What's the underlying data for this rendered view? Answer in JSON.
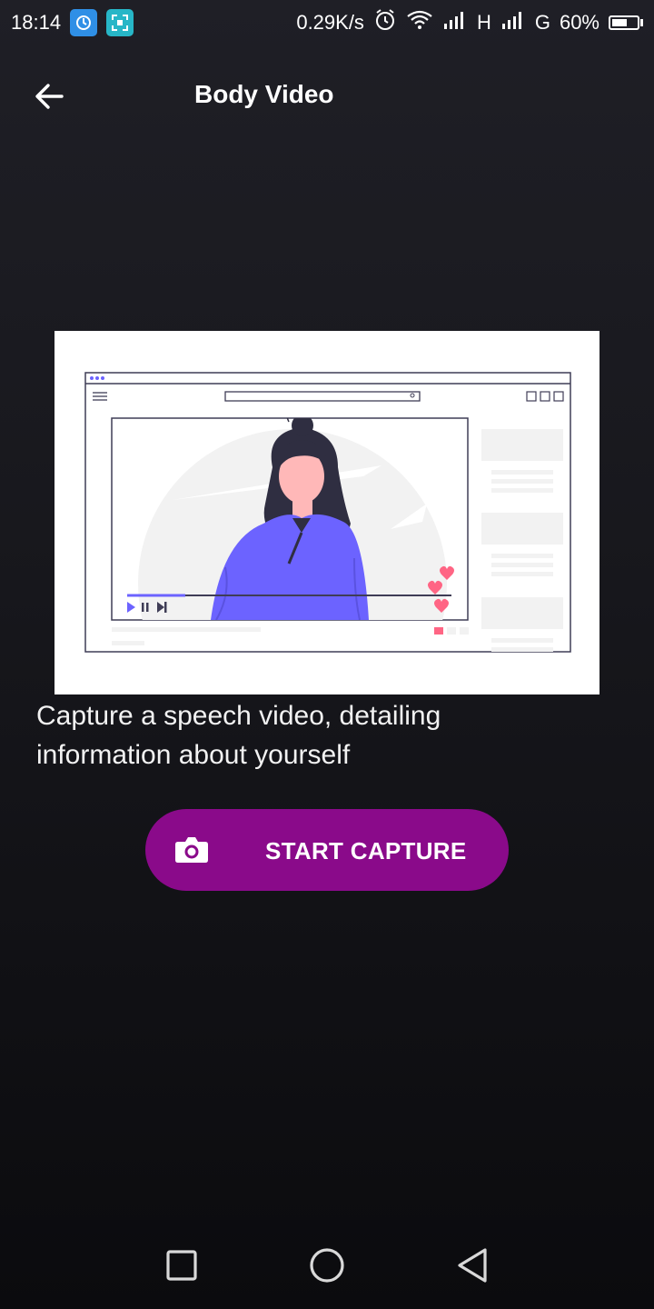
{
  "status_bar": {
    "time": "18:14",
    "net_speed": "0.29K/s",
    "signal_1_type": "H",
    "signal_2_type": "G",
    "battery_percent": "60%",
    "battery_level": 0.6,
    "icons": [
      "vpn-app-icon",
      "scan-app-icon",
      "alarm-icon",
      "wifi-icon",
      "signal-icon",
      "battery-icon"
    ]
  },
  "header": {
    "title": "Body Video",
    "back_icon": "arrow-left-icon"
  },
  "main": {
    "description": "Capture a speech video, detailing information about yourself",
    "button_label": "START CAPTURE",
    "button_icon": "camera-icon"
  },
  "colors": {
    "accent": "#8a0a8a",
    "illustration_purple": "#6c63ff",
    "heart": "#ff6584"
  },
  "nav": {
    "icons": [
      "recent-apps-icon",
      "home-icon",
      "back-triangle-icon"
    ]
  }
}
